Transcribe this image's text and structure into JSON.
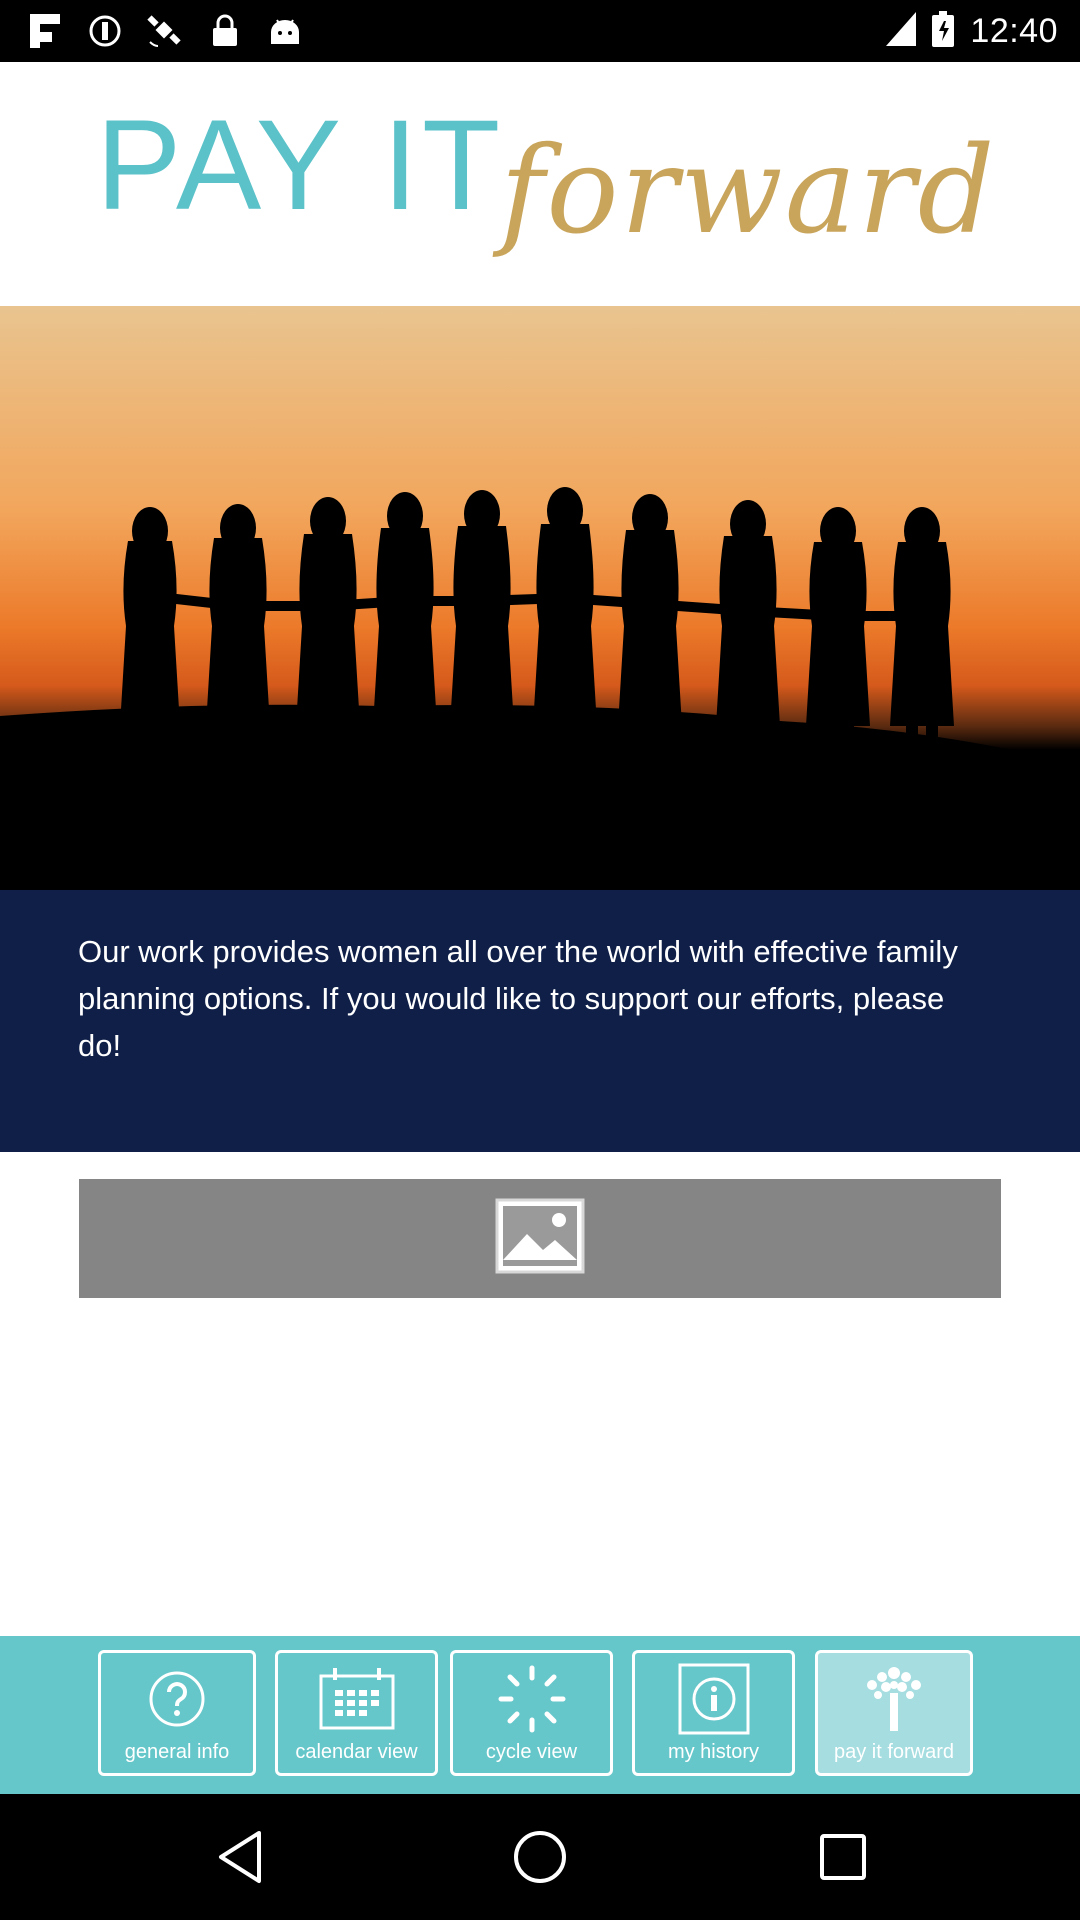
{
  "status_bar": {
    "time": "12:40",
    "left_icons": [
      "flipboard-icon",
      "circle-minus-icon",
      "satellite-icon",
      "lock-icon",
      "android-icon"
    ],
    "right_icons": [
      "signal-icon",
      "battery-icon"
    ]
  },
  "header": {
    "logo_text_primary": "PAY IT",
    "logo_text_script": "forward",
    "colors": {
      "primary": "#5bc2c9",
      "script": "#c9a55c"
    }
  },
  "hero": {
    "image_semantic": "women-holding-hands-silhouette-sunset"
  },
  "info": {
    "text": "Our work provides women all over the world with effective family planning options. If you would like to support our efforts, please do!",
    "background": "#0f1f48"
  },
  "placeholder": {
    "icon": "image-placeholder-icon"
  },
  "tabs": [
    {
      "label": "general info",
      "icon": "question-icon",
      "active": false
    },
    {
      "label": "calendar view",
      "icon": "calendar-icon",
      "active": false
    },
    {
      "label": "cycle view",
      "icon": "cycle-icon",
      "active": false
    },
    {
      "label": "my history",
      "icon": "info-icon",
      "active": false
    },
    {
      "label": "pay it forward",
      "icon": "tree-icon",
      "active": true
    }
  ],
  "nav": {
    "buttons": [
      "back-icon",
      "home-icon",
      "recents-icon"
    ]
  },
  "colors": {
    "tab_bar": "#66c7ca",
    "tab_active": "#a5dde0"
  }
}
